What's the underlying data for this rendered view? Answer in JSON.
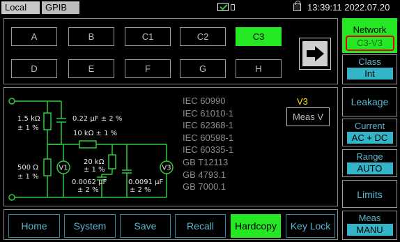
{
  "status_bar": {
    "local_label": "Local",
    "gpib_label": "GPIB",
    "datetime": "13:39:11 2022.07.20"
  },
  "class_buttons": [
    {
      "label": "A",
      "active": false
    },
    {
      "label": "B",
      "active": false
    },
    {
      "label": "C1",
      "active": false
    },
    {
      "label": "C2",
      "active": false
    },
    {
      "label": "C3",
      "active": true
    },
    {
      "label": "D",
      "active": false
    },
    {
      "label": "E",
      "active": false
    },
    {
      "label": "F",
      "active": false
    },
    {
      "label": "G",
      "active": false
    },
    {
      "label": "H",
      "active": false
    }
  ],
  "circuit": {
    "r1": "1.5 kΩ",
    "r1_tol": "± 1 %",
    "c1": "0.22 µF ± 2 %",
    "r2": "10 kΩ ± 1 %",
    "r3": "500 Ω",
    "r3_tol": "± 1 %",
    "r4": "20 kΩ",
    "r4_tol": "± 1 %",
    "c2": "0.0062 µF",
    "c2_tol": "± 2 %",
    "c3": "0.0091 µF",
    "c3_tol": "± 2 %",
    "v1": "V1",
    "v3": "V3"
  },
  "standards": [
    "IEC 60990",
    "IEC 61010-1",
    "IEC 62368-1",
    "IEC 60598-1",
    "IEC 60335-1",
    "GB T12113",
    "GB 4793.1",
    "GB 7000.1"
  ],
  "measure": {
    "network_label": "V3",
    "meas_button": "Meas V"
  },
  "bottom_nav": [
    {
      "label": "Home",
      "active": false
    },
    {
      "label": "System",
      "active": false
    },
    {
      "label": "Save",
      "active": false
    },
    {
      "label": "Recall",
      "active": false
    },
    {
      "label": "Hardcopy",
      "active": true
    },
    {
      "label": "Key Lock",
      "active": false
    }
  ],
  "sidebar": {
    "network": {
      "label": "Network",
      "value": "C3-V3"
    },
    "class": {
      "label": "Class",
      "value": "Int"
    },
    "leakage": {
      "label": "Leakage"
    },
    "current": {
      "label": "Current",
      "value": "AC + DC"
    },
    "range": {
      "label": "Range",
      "value": "AUTO"
    },
    "limits": {
      "label": "Limits"
    },
    "meas": {
      "label": "Meas",
      "value": "MANU"
    }
  },
  "colors": {
    "active_green": "#25e825",
    "accent_cyan": "#34b4c8",
    "highlight_red": "#e00000",
    "network_yellow": "#ffde00"
  },
  "icons": [
    "mail-check-icon",
    "memory-icon",
    "lock-icon",
    "arrow-right-icon"
  ]
}
